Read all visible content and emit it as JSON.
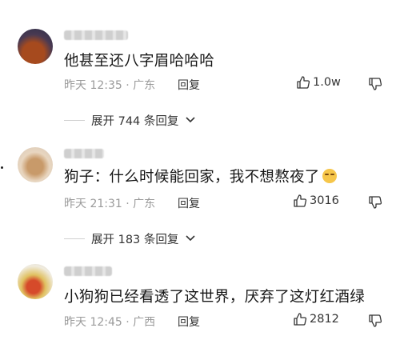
{
  "comments": [
    {
      "text": "他甚至还八字眉哈哈哈",
      "time": "昨天 12:35 · 广东",
      "reply_label": "回复",
      "likes": "1.0w"
    },
    {
      "text": "狗子：什么时候能回家，我不想熬夜了",
      "emoji_icon": "smirk-face-emoji",
      "time": "昨天 21:31 · 广东",
      "reply_label": "回复",
      "likes": "3016"
    },
    {
      "text": "小狗狗已经看透了这世界，厌弃了这灯红酒绿",
      "time": "昨天 12:45 · 广西",
      "reply_label": "回复",
      "likes": "2812"
    }
  ],
  "expand_replies": [
    {
      "label": "展开 744 条回复"
    },
    {
      "label": "展开 183 条回复"
    }
  ]
}
